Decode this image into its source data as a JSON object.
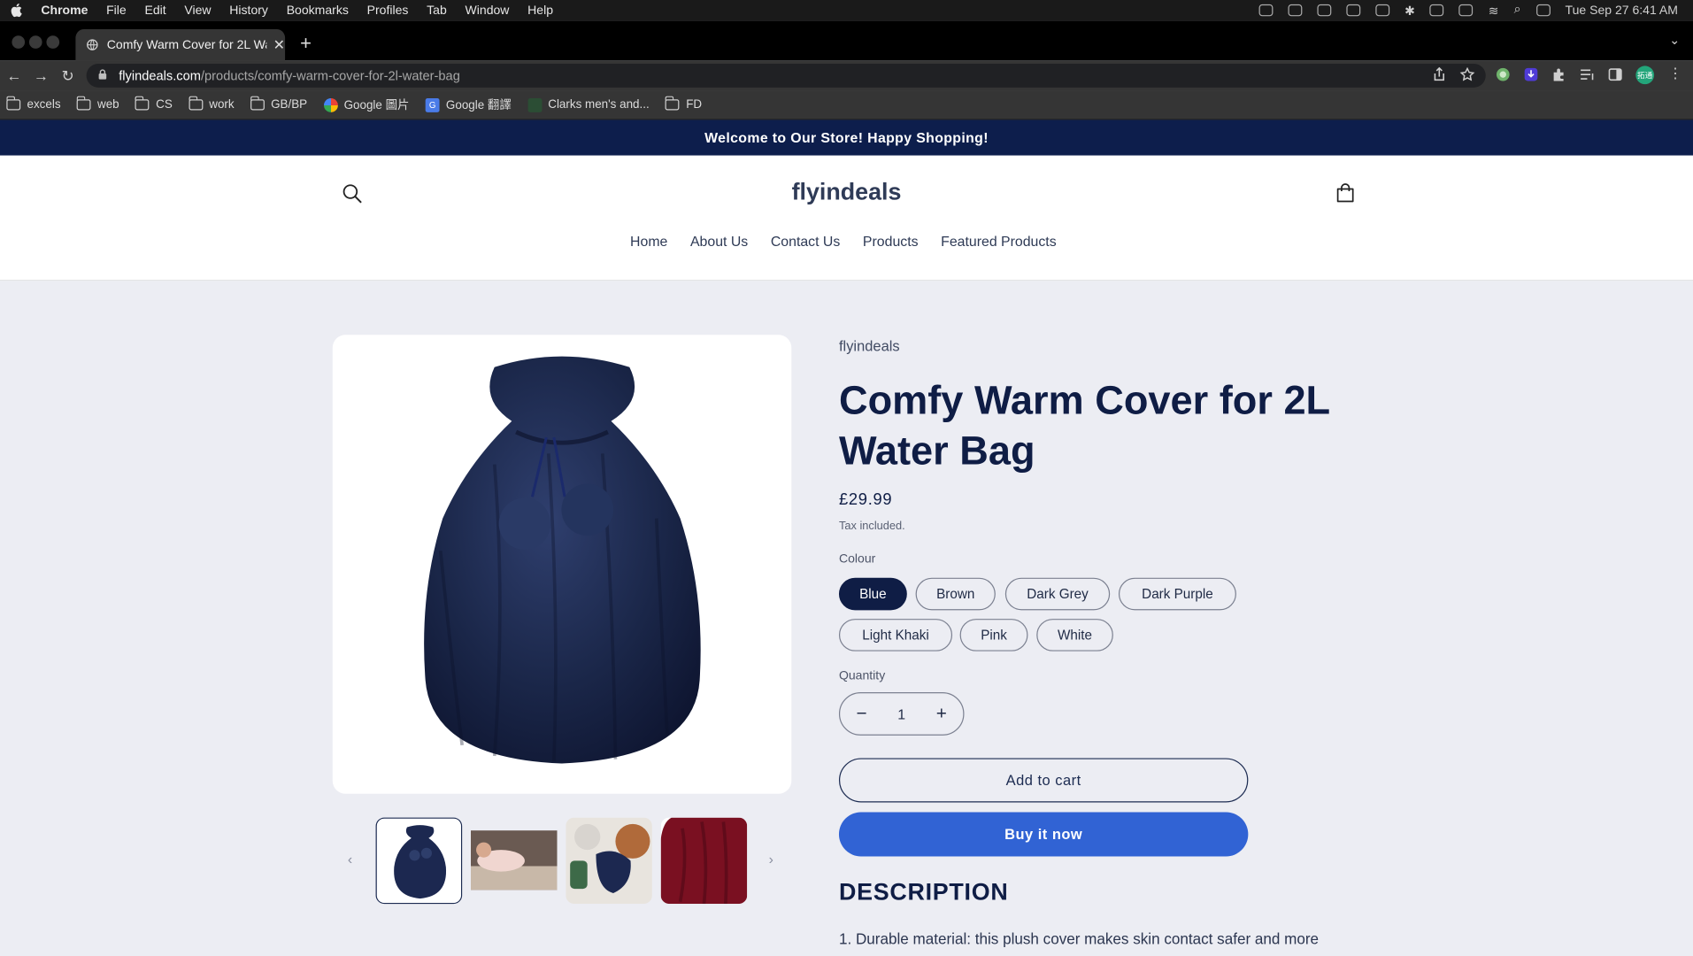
{
  "os_menubar": {
    "app": "Chrome",
    "menus": [
      "File",
      "Edit",
      "View",
      "History",
      "Bookmarks",
      "Profiles",
      "Tab",
      "Window",
      "Help"
    ],
    "clock": "Tue Sep 27  6:41 AM"
  },
  "browser": {
    "tab_title": "Comfy Warm Cover for 2L Wate",
    "url_host": "flyindeals.com",
    "url_path": "/products/comfy-warm-cover-for-2l-water-bag",
    "bookmarks": [
      "excels",
      "web",
      "CS",
      "work",
      "GB/BP",
      "Google 圖片",
      "Google 翻譯",
      "Clarks men's and...",
      "FD"
    ],
    "profile_badge": "拓通"
  },
  "store": {
    "announcement": "Welcome to Our Store! Happy Shopping!",
    "logo": "flyindeals",
    "nav": [
      "Home",
      "About Us",
      "Contact Us",
      "Products",
      "Featured Products"
    ]
  },
  "product": {
    "vendor": "flyindeals",
    "title": "Comfy Warm Cover for 2L Water Bag",
    "price": "£29.99",
    "tax_note": "Tax included.",
    "colour_label": "Colour",
    "colours": [
      "Blue",
      "Brown",
      "Dark Grey",
      "Dark Purple",
      "Light Khaki",
      "Pink",
      "White"
    ],
    "selected_colour": "Blue",
    "quantity_label": "Quantity",
    "quantity": "1",
    "add_to_cart": "Add to cart",
    "buy_now": "Buy it now",
    "description_heading": "DESCRIPTION",
    "description_first_line": "1. Durable material: this plush cover makes skin contact safer and more"
  },
  "colors": {
    "announcement_bg": "#0d1e4c",
    "accent_blue": "#3163d4",
    "navy_text": "#0f1d45",
    "page_bg": "#ecedf3"
  }
}
